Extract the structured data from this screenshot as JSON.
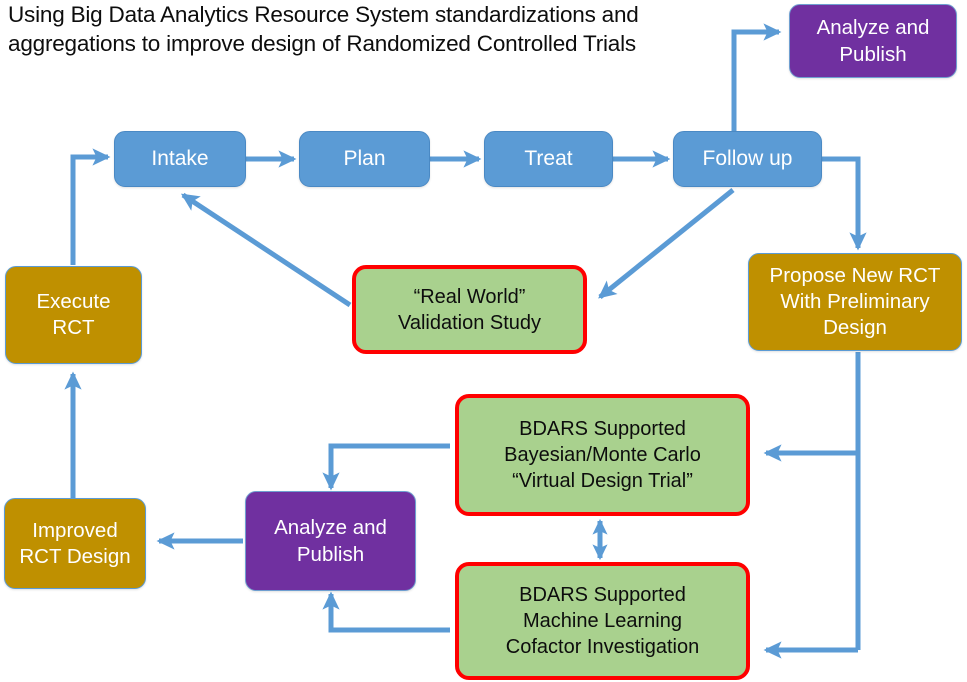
{
  "title": "Using Big Data Analytics Resource System standardizations and\naggregations to improve design of Randomized Controlled Trials",
  "colors": {
    "blue": "#5B9BD5",
    "gold": "#BF9000",
    "purple": "#7030A0",
    "green": "#A9D18E",
    "green_border": "#FF0000",
    "arrow": "#5B9BD5",
    "text_dark": "#0D0D0D",
    "text_light": "#FFFFFF",
    "background": "#FFFFFF"
  },
  "nodes": {
    "analyze_publish_top": {
      "label": "Analyze and\nPublish",
      "type": "purple"
    },
    "intake": {
      "label": "Intake",
      "type": "blue"
    },
    "plan": {
      "label": "Plan",
      "type": "blue"
    },
    "treat": {
      "label": "Treat",
      "type": "blue"
    },
    "follow_up": {
      "label": "Follow up",
      "type": "blue"
    },
    "execute_rct": {
      "label": "Execute\nRCT",
      "type": "gold"
    },
    "real_world_validation": {
      "label": "“Real World”\nValidation Study",
      "type": "green"
    },
    "propose_new_rct": {
      "label": "Propose New RCT\nWith Preliminary\nDesign",
      "type": "gold"
    },
    "bdars_bayesian": {
      "label": "BDARS Supported\nBayesian/Monte Carlo\n“Virtual Design Trial”",
      "type": "green"
    },
    "bdars_machine_learning": {
      "label": "BDARS Supported\nMachine Learning\nCofactor Investigation",
      "type": "green"
    },
    "improved_rct_design": {
      "label": "Improved\nRCT Design",
      "type": "gold"
    },
    "analyze_publish_bottom": {
      "label": "Analyze and\nPublish",
      "type": "purple"
    }
  },
  "edges": [
    {
      "name": "execute-rct-to-intake",
      "from": "execute_rct",
      "to": "intake",
      "style": "elbow"
    },
    {
      "name": "intake-to-plan",
      "from": "intake",
      "to": "plan",
      "style": "straight"
    },
    {
      "name": "plan-to-treat",
      "from": "plan",
      "to": "treat",
      "style": "straight"
    },
    {
      "name": "treat-to-follow-up",
      "from": "treat",
      "to": "follow_up",
      "style": "straight"
    },
    {
      "name": "follow-up-to-analyze-publish-top",
      "from": "follow_up",
      "to": "analyze_publish_top",
      "style": "elbow"
    },
    {
      "name": "follow-up-to-real-world-validation",
      "from": "follow_up",
      "to": "real_world_validation",
      "style": "diagonal"
    },
    {
      "name": "real-world-validation-to-intake",
      "from": "real_world_validation",
      "to": "intake",
      "style": "diagonal"
    },
    {
      "name": "follow-up-to-propose-new-rct",
      "from": "follow_up",
      "to": "propose_new_rct",
      "style": "elbow"
    },
    {
      "name": "propose-new-rct-to-bdars-bayesian",
      "from": "propose_new_rct",
      "to": "bdars_bayesian",
      "style": "elbow"
    },
    {
      "name": "propose-new-rct-to-bdars-machine-learning",
      "from": "propose_new_rct",
      "to": "bdars_machine_learning",
      "style": "elbow"
    },
    {
      "name": "bdars-bayesian-to-bdars-machine-learning",
      "from": "bdars_bayesian",
      "to": "bdars_machine_learning",
      "style": "bidirectional"
    },
    {
      "name": "bdars-bayesian-to-analyze-publish-bottom",
      "from": "bdars_bayesian",
      "to": "analyze_publish_bottom",
      "style": "elbow"
    },
    {
      "name": "bdars-machine-learning-to-analyze-publish-bottom",
      "from": "bdars_machine_learning",
      "to": "analyze_publish_bottom",
      "style": "elbow"
    },
    {
      "name": "analyze-publish-bottom-to-improved-rct-design",
      "from": "analyze_publish_bottom",
      "to": "improved_rct_design",
      "style": "straight"
    },
    {
      "name": "improved-rct-design-to-execute-rct",
      "from": "improved_rct_design",
      "to": "execute_rct",
      "style": "straight"
    }
  ]
}
